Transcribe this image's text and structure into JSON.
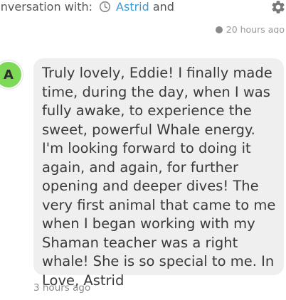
{
  "header": {
    "prefix": "onversation with:",
    "contact": "Astrid",
    "suffix": "and"
  },
  "previous_message": {
    "time": "20 hours ago"
  },
  "message": {
    "avatar_initial": "A",
    "text": "Truly lovely, Eddie! I finally made time, during the day, when I was fully awake, to experience the sweet, powerful Whale energy. I'm looking forward to doing it again, and again, for further opening and deeper dives! The very first animal that came to me when I began working with my Shaman teacher was a right whale! She is so special to me. In Love, Astrid",
    "time": "3 hours ago"
  },
  "icons": {
    "clock": "clock-icon",
    "settings": "gear-icon"
  },
  "colors": {
    "link": "#3a9bd9",
    "avatar_bg": "#7ed957",
    "bubble_bg": "#efefef"
  }
}
